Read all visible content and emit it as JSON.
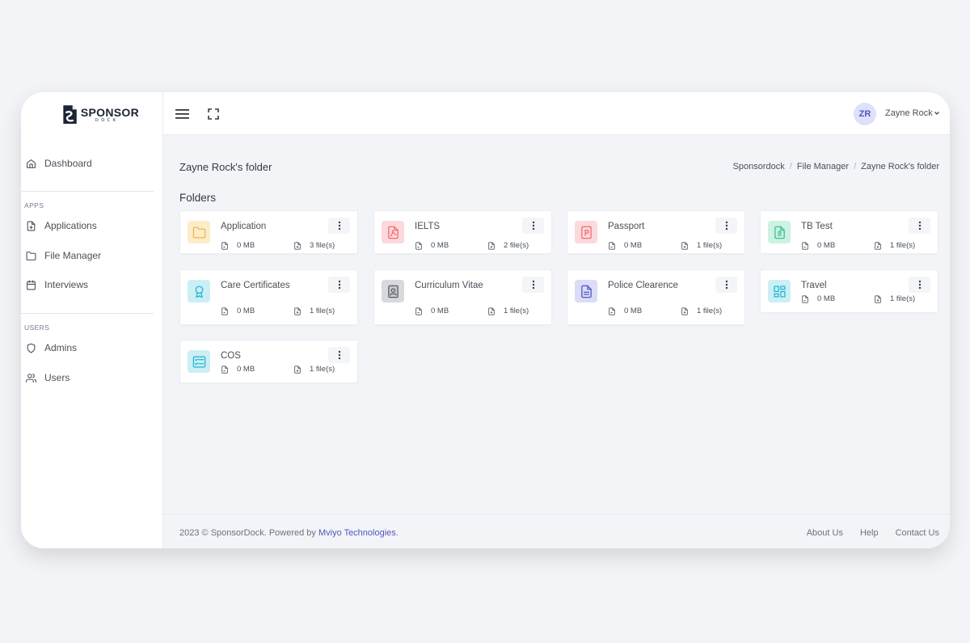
{
  "brand": {
    "name": "SPONSOR",
    "sub": "DOCK"
  },
  "sidebar": {
    "items_top": [
      {
        "label": "Dashboard",
        "icon": "home-icon"
      }
    ],
    "apps_title": "APPS",
    "apps": [
      {
        "label": "Applications",
        "icon": "file-plus-icon"
      },
      {
        "label": "File Manager",
        "icon": "folder-icon"
      },
      {
        "label": "Interviews",
        "icon": "calendar-icon"
      }
    ],
    "users_title": "USERS",
    "users": [
      {
        "label": "Admins",
        "icon": "shield-icon"
      },
      {
        "label": "Users",
        "icon": "users-icon"
      }
    ]
  },
  "topbar": {
    "menu_icon": "hamburger-icon",
    "fullscreen_icon": "fullscreen-icon",
    "user": {
      "initials": "ZR",
      "name": "Zayne Rock"
    }
  },
  "page": {
    "title": "Zayne Rock's folder",
    "breadcrumb": [
      "Sponsordock",
      "File Manager",
      "Zayne Rock's folder"
    ],
    "section_title": "Folders"
  },
  "folders": [
    {
      "name": "Application",
      "size": "0 MB",
      "count": "3 file(s)",
      "icon": "folder-icon",
      "bg": "#fdecc8",
      "fg": "#f1b44c"
    },
    {
      "name": "IELTS",
      "size": "0 MB",
      "count": "2 file(s)",
      "icon": "pdf-icon",
      "bg": "#fbd9dd",
      "fg": "#f46a6a"
    },
    {
      "name": "Passport",
      "size": "0 MB",
      "count": "1 file(s)",
      "icon": "passport-icon",
      "bg": "#fbd9dd",
      "fg": "#f46a6a"
    },
    {
      "name": "TB Test",
      "size": "0 MB",
      "count": "1 file(s)",
      "icon": "document-icon",
      "bg": "#cdf1e2",
      "fg": "#34c38f"
    },
    {
      "name": "Care Certificates",
      "size": "0 MB",
      "count": "1 file(s)",
      "icon": "certificate-icon",
      "bg": "#cceef5",
      "fg": "#1eb6d6"
    },
    {
      "name": "Curriculum Vitae",
      "size": "0 MB",
      "count": "1 file(s)",
      "icon": "id-card-icon",
      "bg": "#d7d9dc",
      "fg": "#5b6068"
    },
    {
      "name": "Police Clearence",
      "size": "0 MB",
      "count": "1 file(s)",
      "icon": "file-text-icon",
      "bg": "#dadcf8",
      "fg": "#5156be"
    },
    {
      "name": "Travel",
      "size": "0 MB",
      "count": "1 file(s)",
      "icon": "layout-icon",
      "bg": "#cceef5",
      "fg": "#1eb6d6"
    },
    {
      "name": "COS",
      "size": "0 MB",
      "count": "1 file(s)",
      "icon": "checklist-icon",
      "bg": "#cceef5",
      "fg": "#1eb6d6"
    }
  ],
  "footer": {
    "copyright": "2023 © SponsorDock. Powered by ",
    "company": "Mviyo Technologies",
    "dot": ".",
    "links": [
      "About Us",
      "Help",
      "Contact Us"
    ]
  }
}
